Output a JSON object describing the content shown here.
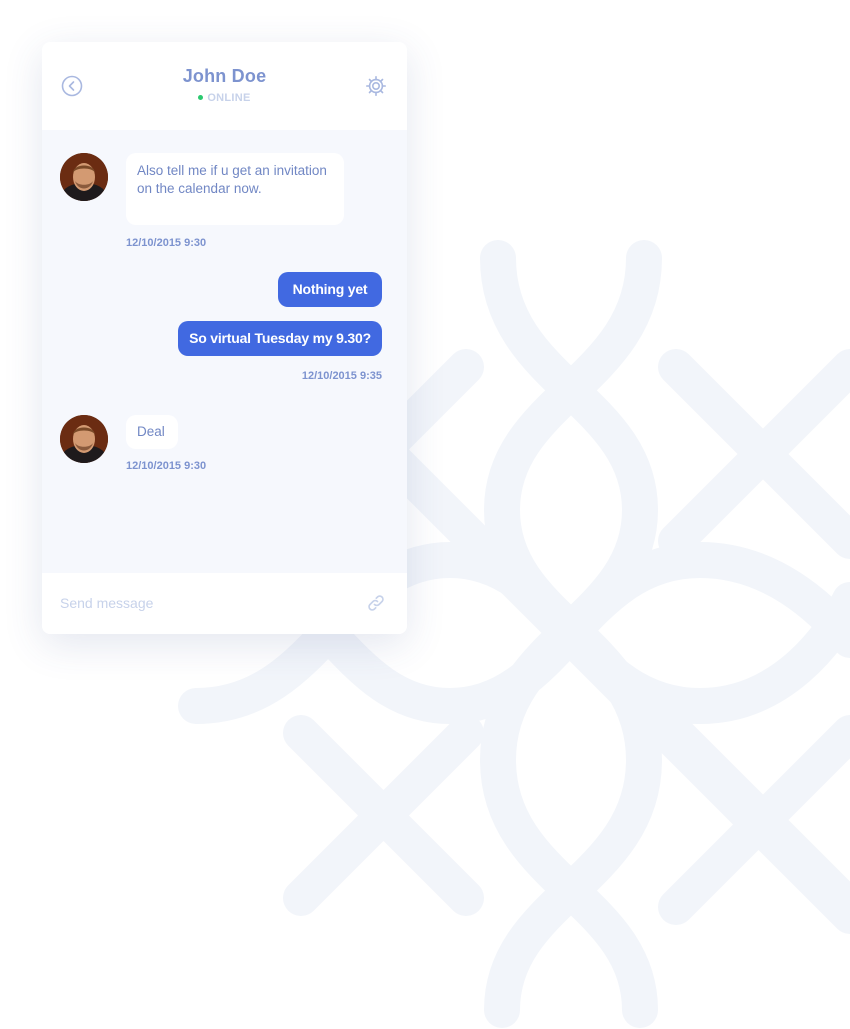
{
  "header": {
    "contact_name": "John Doe",
    "status": "ONLINE",
    "status_color": "#2bc96f",
    "back_icon": "chevron-left-circle-icon",
    "settings_icon": "gear-icon"
  },
  "messages": [
    {
      "direction": "incoming",
      "text": "Also tell me if u get an invitation on the calendar now.",
      "time": "12/10/2015 9:30"
    },
    {
      "direction": "outgoing",
      "text": "Nothing yet"
    },
    {
      "direction": "outgoing",
      "text": "So virtual Tuesday my 9.30?",
      "time": "12/10/2015 9:35"
    },
    {
      "direction": "incoming",
      "text": "Deal",
      "time": "12/10/2015 9:30"
    }
  ],
  "composer": {
    "placeholder": "Send message",
    "attach_icon": "link-icon"
  },
  "colors": {
    "accent": "#4169e1",
    "text_primary": "#7d93cf",
    "chat_background": "#f6f8fd"
  }
}
